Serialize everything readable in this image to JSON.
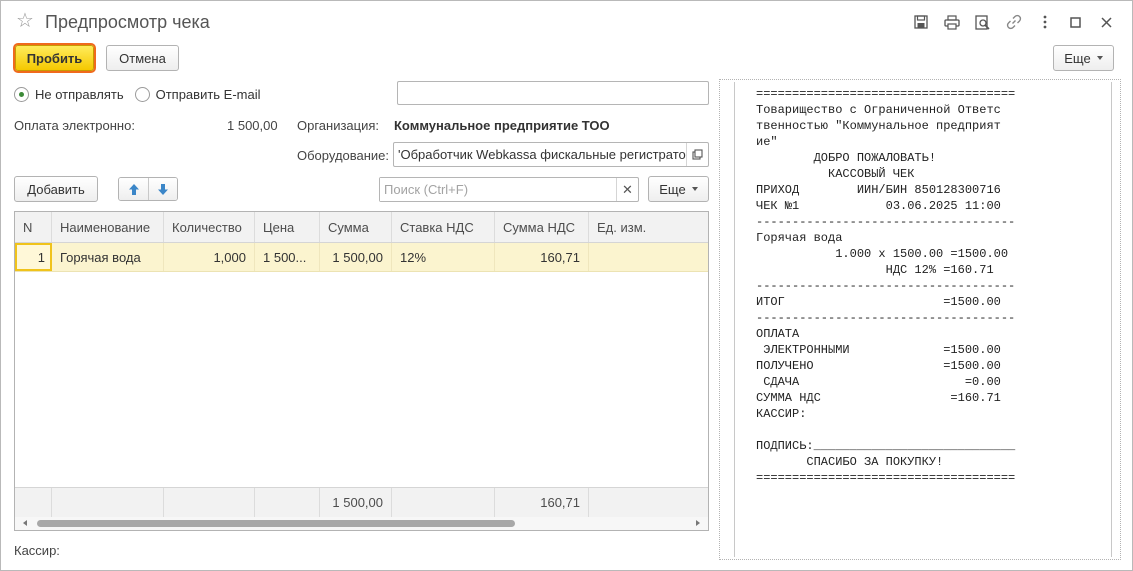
{
  "window": {
    "title": "Предпросмотр чека",
    "icons": [
      "save-icon",
      "print-icon",
      "print-preview-icon",
      "link-icon",
      "more-vertical-icon",
      "maximize-icon",
      "close-icon"
    ]
  },
  "toolbar": {
    "primary_label": "Пробить",
    "cancel_label": "Отмена",
    "more_label": "Еще"
  },
  "send": {
    "options": [
      "Не отправлять",
      "Отправить E-mail"
    ],
    "selected": "Не отправлять",
    "email_value": ""
  },
  "payment": {
    "label": "Оплата электронно:",
    "value": "1 500,00"
  },
  "organization": {
    "label": "Организация:",
    "value": "Коммунальное предприятие ТОО"
  },
  "equipment": {
    "label": "Оборудование:",
    "value": "'Обработчик Webkassa фискальные регистраторы"
  },
  "list_toolbar": {
    "add_label": "Добавить",
    "search_placeholder": "Поиск (Ctrl+F)",
    "more_label": "Еще"
  },
  "table": {
    "columns": [
      "N",
      "Наименование",
      "Количество",
      "Цена",
      "Сумма",
      "Ставка НДС",
      "Сумма НДС",
      "Ед. изм."
    ],
    "rows": [
      {
        "n": "1",
        "name": "Горячая вода",
        "qty": "1,000",
        "price": "1 500...",
        "sum": "1 500,00",
        "vat_rate": "12%",
        "vat_sum": "160,71",
        "unit": ""
      }
    ],
    "totals": {
      "sum": "1 500,00",
      "vat_sum": "160,71"
    }
  },
  "cashier": {
    "label": "Кассир:"
  },
  "receipt": {
    "text": "====================================\nТоварищество с Ограниченной Ответс\nтвенностью \"Коммунальное предприят\nие\"\n        ДОБРО ПОЖАЛОВАТЬ!\n          КАССОВЫЙ ЧЕК\nПРИХОД        ИИН/БИН 850128300716\nЧЕК №1            03.06.2025 11:00\n------------------------------------\nГорячая вода\n           1.000 x 1500.00 =1500.00\n                  НДС 12% =160.71\n------------------------------------\nИТОГ                      =1500.00\n------------------------------------\nОПЛАТА\n ЭЛЕКТРОННЫМИ             =1500.00\nПОЛУЧЕНО                  =1500.00\n СДАЧА                       =0.00\nСУММА НДС                  =160.71\nКАССИР:\n\nПОДПИСЬ:____________________________\n       СПАСИБО ЗА ПОКУПКУ!\n===================================="
  },
  "colors": {
    "primary_button": "#f5c800",
    "primary_outline": "#f06a1d",
    "selected_row": "#fbf4cf",
    "radio_dot": "#3c8a38",
    "arrow_icon": "#3b86c8"
  }
}
